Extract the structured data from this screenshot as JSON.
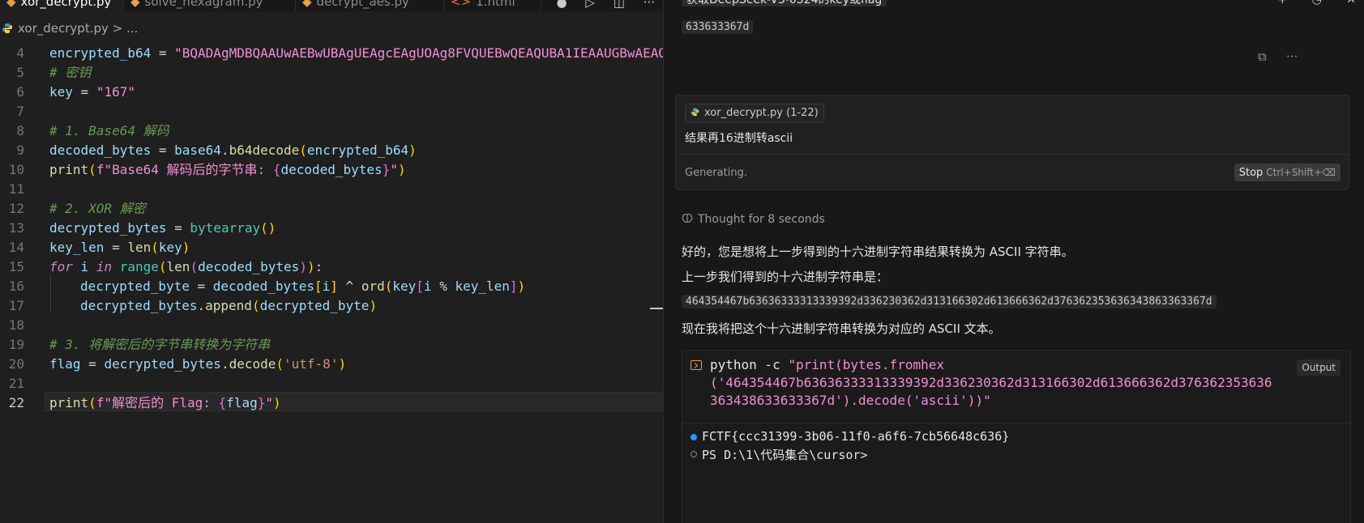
{
  "editor": {
    "tabs": [
      {
        "label": "xor_decrypt.py",
        "active": true
      },
      {
        "label": "solve_hexagram.py",
        "active": false
      },
      {
        "label": "decrypt_aes.py",
        "active": false
      },
      {
        "label": "1.html",
        "active": false
      }
    ],
    "breadcrumb": {
      "file": "xor_decrypt.py",
      "sep": ">",
      "more": "..."
    },
    "current_line": 22,
    "line_numbers": [
      "4",
      "5",
      "6",
      "7",
      "8",
      "9",
      "10",
      "11",
      "12",
      "13",
      "14",
      "15",
      "16",
      "17",
      "18",
      "19",
      "20",
      "21",
      "22"
    ],
    "code": {
      "l4_var": "encrypted_b64",
      "l4_op": " = ",
      "l4_str": "\"BQADAgMDBQAAUwAEBwUBAgUEAgcEAgUOAg8FVQUEBwQEAQUBA1IEAAUGBwAEAQ",
      "l5_com": "# 密钥",
      "l6_var": "key",
      "l6_op": " = ",
      "l6_str": "\"167\"",
      "l8_com": "# 1. Base64 解码",
      "l9_var": "decoded_bytes",
      "l9_op": " = ",
      "l9_mod": "base64",
      "l9_dot": ".",
      "l9_fn": "b64decode",
      "l9_p1": "(",
      "l9_arg": "encrypted_b64",
      "l9_p2": ")",
      "l10_fn": "print",
      "l10_p1": "(",
      "l10_f": "f",
      "l10_s1": "\"Base64 解码后的字节串: ",
      "l10_b1": "{",
      "l10_v": "decoded_bytes",
      "l10_b2": "}",
      "l10_s2": "\"",
      "l10_p2": ")",
      "l12_com": "# 2. XOR 解密",
      "l13_var": "decrypted_bytes",
      "l13_op": " = ",
      "l13_fn": "bytearray",
      "l13_p": "()",
      "l14_var": "key_len",
      "l14_op": " = ",
      "l14_fn": "len",
      "l14_p1": "(",
      "l14_arg": "key",
      "l14_p2": ")",
      "l15_kw": "for",
      "l15_i": " i ",
      "l15_in": "in",
      "l15_sp": " ",
      "l15_range": "range",
      "l15_p1": "(",
      "l15_len": "len",
      "l15_p2": "(",
      "l15_arg": "decoded_bytes",
      "l15_p3": ")",
      "l15_p4": ")",
      "l15_colon": ":",
      "l16_var": "decrypted_byte",
      "l16_op": " = ",
      "l16_arr": "decoded_bytes",
      "l16_b1": "[",
      "l16_i": "i",
      "l16_b2": "]",
      "l16_xor": " ^ ",
      "l16_ord": "ord",
      "l16_p1": "(",
      "l16_key": "key",
      "l16_b3": "[",
      "l16_i2": "i",
      "l16_mod": " % ",
      "l16_kl": "key_len",
      "l16_b4": "]",
      "l16_p2": ")",
      "l17_var": "decrypted_bytes",
      "l17_dot": ".",
      "l17_fn": "append",
      "l17_p1": "(",
      "l17_arg": "decrypted_byte",
      "l17_p2": ")",
      "l19_com": "# 3. 将解密后的字节串转换为字符串",
      "l20_var": "flag",
      "l20_op": " = ",
      "l20_obj": "decrypted_bytes",
      "l20_dot": ".",
      "l20_fn": "decode",
      "l20_p1": "(",
      "l20_str": "'utf-8'",
      "l20_p2": ")",
      "l22_fn": "print",
      "l22_p1": "(",
      "l22_f": "f",
      "l22_s1": "\"解密后的 Flag: ",
      "l22_b1": "{",
      "l22_v": "flag",
      "l22_b2": "}",
      "l22_s2": "\"",
      "l22_p2": ")"
    }
  },
  "chat": {
    "top_question": "获取DeepSeek-V3-0324的key或flag",
    "top_hex": "633633367d",
    "input": {
      "file_chip": "xor_decrypt.py (1-22)",
      "prompt": "结果再16进制转ascii",
      "status": "Generating.",
      "stop_label": "Stop",
      "stop_shortcut": "Ctrl+Shift+⌫"
    },
    "thought": "Thought for 8 seconds",
    "para1": "好的，您是想将上一步得到的十六进制字符串结果转换为 ASCII 字符串。",
    "para2": "上一步我们得到的十六进制字符串是：",
    "hex_string": "464354467b63636333313339392d336230362d313166302d613666362d376362353636343863363367d",
    "para3": "现在我将把这个十六进制字符串转换为对应的 ASCII 文本。",
    "terminal": {
      "cmd_line1_a": "python -c ",
      "cmd_line1_b": "\"print(bytes.fromhex",
      "cmd_line2": "('464354467b63636333313339392d336230362d313166302d613666362d376362353636",
      "cmd_line3": "363438633633367d').decode('ascii'))\"",
      "output_label": "Output",
      "result": "FCTF{ccc31399-3b06-11f0-a6f6-7cb56648c636}",
      "prompt": "PS D:\\1\\代码集合\\cursor>"
    }
  }
}
